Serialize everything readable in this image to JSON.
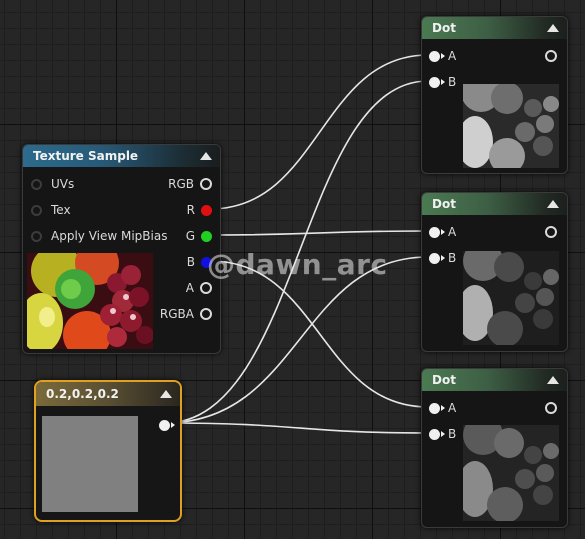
{
  "texture_node": {
    "title": "Texture Sample",
    "inputs": [
      {
        "label": "UVs"
      },
      {
        "label": "Tex"
      },
      {
        "label": "Apply View MipBias"
      }
    ],
    "outputs": [
      {
        "label": "RGB",
        "color": "#ffffff"
      },
      {
        "label": "R",
        "color": "#e01010"
      },
      {
        "label": "G",
        "color": "#22d022"
      },
      {
        "label": "B",
        "color": "#1010e0"
      },
      {
        "label": "A",
        "color": "#ffffff"
      },
      {
        "label": "RGBA",
        "color": "#ffffff"
      }
    ],
    "header_color": "#2d6a8c"
  },
  "constant_node": {
    "title": "0.2,0.2,0.2",
    "swatch_color": "#808080",
    "border_color": "#e0a020"
  },
  "dot_nodes": [
    {
      "title": "Dot",
      "input_a": "A",
      "input_b": "B"
    },
    {
      "title": "Dot",
      "input_a": "A",
      "input_b": "B"
    },
    {
      "title": "Dot",
      "input_a": "A",
      "input_b": "B"
    }
  ],
  "watermark": "@dawn_arc",
  "colors": {
    "grid_bg": "#262626",
    "wire": "#e8e8e8",
    "dot_header": "#4a7a52"
  }
}
